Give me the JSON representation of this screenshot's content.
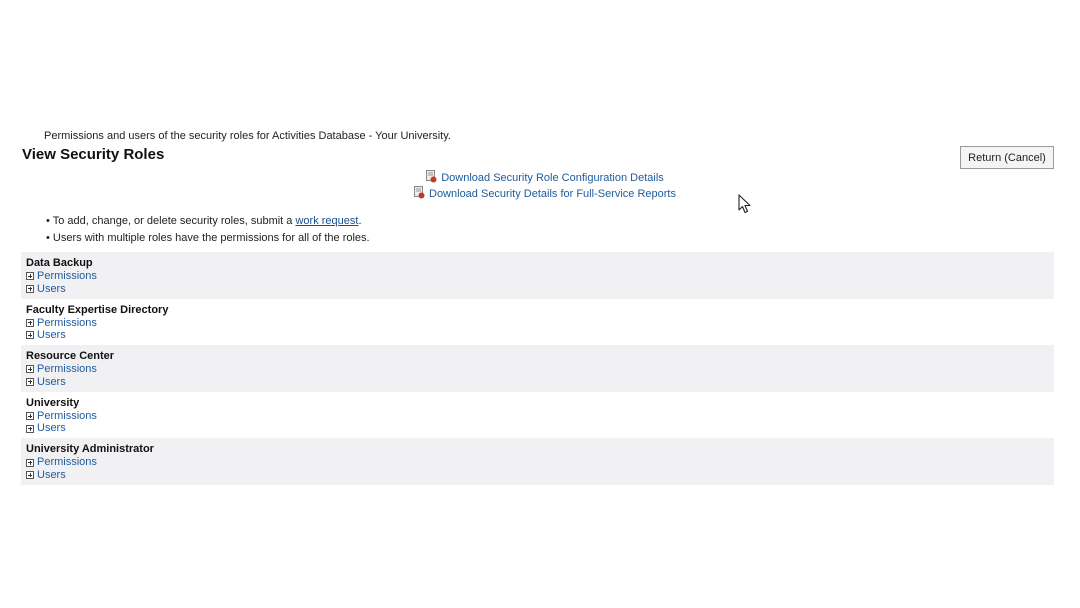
{
  "header": {
    "subtitle": "Permissions and users of the security roles for Activities Database - Your University.",
    "title": "View Security Roles",
    "return_label": "Return (Cancel)"
  },
  "downloads": [
    {
      "label": "Download Security Role Configuration Details",
      "icon": "document-icon"
    },
    {
      "label": "Download Security Details for Full-Service Reports",
      "icon": "document-icon"
    }
  ],
  "notes": {
    "note1_prefix": "To add, change, or delete security roles, submit a ",
    "note1_link": "work request",
    "note1_suffix": ".",
    "note2": "Users with multiple roles have the permissions for all of the roles."
  },
  "roles": [
    {
      "name": "Data Backup",
      "permissions_label": "Permissions",
      "users_label": "Users"
    },
    {
      "name": "Faculty Expertise Directory",
      "permissions_label": "Permissions",
      "users_label": "Users"
    },
    {
      "name": "Resource Center",
      "permissions_label": "Permissions",
      "users_label": "Users"
    },
    {
      "name": "University",
      "permissions_label": "Permissions",
      "users_label": "Users"
    },
    {
      "name": "University Administrator",
      "permissions_label": "Permissions",
      "users_label": "Users"
    }
  ],
  "colors": {
    "link": "#1e5b9e",
    "row_alt": "#f1f1f4"
  }
}
